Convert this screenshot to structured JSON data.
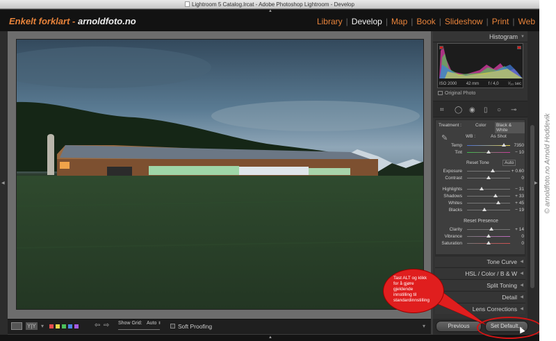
{
  "window": {
    "title": "Lightroom 5 Catalog.lrcat - Adobe Photoshop Lightroom - Develop"
  },
  "identity": {
    "brand_main": "Enkelt forklart - ",
    "brand_site": "arnoldfoto.no"
  },
  "modules": {
    "library": "Library",
    "develop": "Develop",
    "map": "Map",
    "book": "Book",
    "slideshow": "Slideshow",
    "print": "Print",
    "web": "Web",
    "separator": "|"
  },
  "histogram": {
    "title": "Histogram",
    "iso": "ISO 2000",
    "focal": "42 mm",
    "aperture": "f / 4,0",
    "shutter": "¹⁄₃₀ sec",
    "original_photo": "Original Photo"
  },
  "basic": {
    "treatment_label": "Treatment :",
    "color": "Color",
    "bw": "Black & White",
    "wb_label": "WB :",
    "wb_value": "As Shot",
    "temp_label": "Temp",
    "temp_value": "7350",
    "tint_label": "Tint",
    "tint_value": "− 10",
    "reset_tone": "Reset Tone",
    "auto": "Auto",
    "exposure_label": "Exposure",
    "exposure_value": "+ 0.60",
    "contrast_label": "Contrast",
    "contrast_value": "0",
    "highlights_label": "Highlights",
    "highlights_value": "− 31",
    "shadows_label": "Shadows",
    "shadows_value": "+ 33",
    "whites_label": "Whites",
    "whites_value": "+ 45",
    "blacks_label": "Blacks",
    "blacks_value": "− 19",
    "reset_presence": "Reset Presence",
    "clarity_label": "Clarity",
    "clarity_value": "+ 14",
    "vibrance_label": "Vibrance",
    "vibrance_value": "0",
    "saturation_label": "Saturation",
    "saturation_value": "0"
  },
  "panels": {
    "tone_curve": "Tone Curve",
    "hsl": "HSL  /  Color  /  B & W",
    "split_toning": "Split Toning",
    "detail": "Detail",
    "lens_corrections": "Lens Corrections"
  },
  "buttons": {
    "previous": "Previous",
    "set_default": "Set Default..."
  },
  "toolbar": {
    "show_grid": "Show Grid:",
    "grid_value": "Auto",
    "soft_proofing": "Soft Proofing",
    "yy": "Y|Y"
  },
  "tooltip": {
    "line1": "Tast ALT og klikk",
    "line2": "for å gjøre",
    "line3": "gjeldende",
    "line4": "innstilling til",
    "line5": "standardinnstilling"
  },
  "watermark": {
    "text": "© arnoldfoto.no Arnold Hoddevik"
  },
  "colors": {
    "accent_orange": "#e8833a",
    "callout_red": "#e01e1e",
    "panel_bg": "#323232"
  }
}
